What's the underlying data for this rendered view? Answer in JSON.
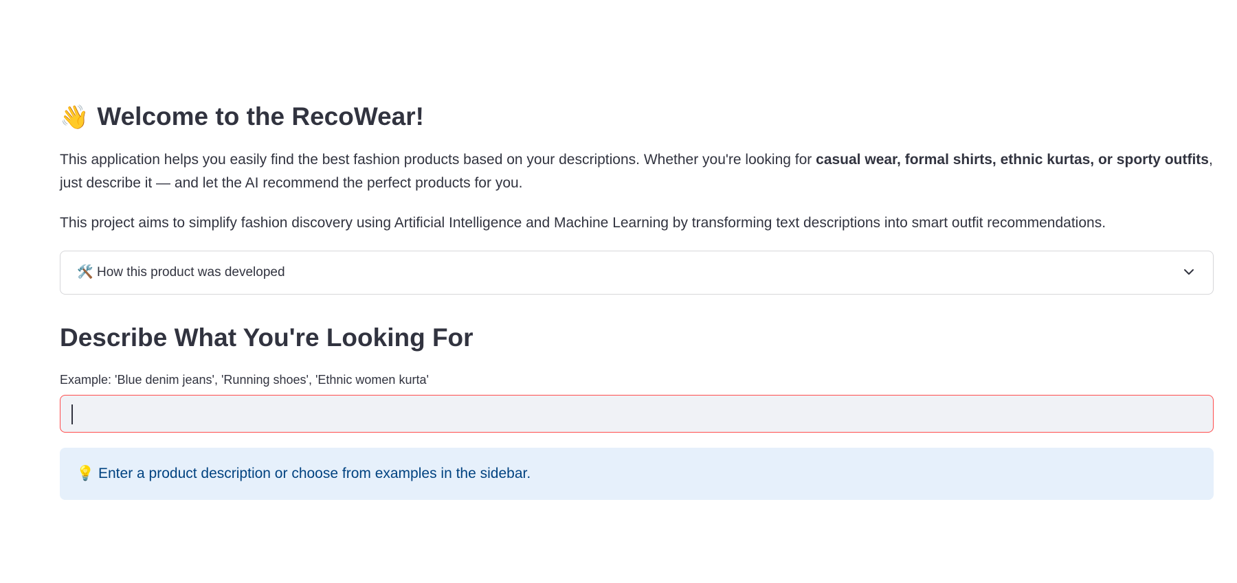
{
  "header": {
    "emoji": "👋",
    "title": "Welcome to the RecoWear!"
  },
  "intro": {
    "text_before": "This application helps you easily find the best fashion products based on your descriptions. Whether you're looking for ",
    "bold_text": "casual wear, formal shirts, ethnic kurtas, or sporty outfits",
    "text_after": ", just describe it — and let the AI recommend the perfect products for you."
  },
  "aim": {
    "text": "This project aims to simplify fashion discovery using Artificial Intelligence and Machine Learning by transforming text descriptions into smart outfit recommendations."
  },
  "expander": {
    "emoji": "🛠️",
    "label": "How this product was developed",
    "expanded": false
  },
  "search_section": {
    "heading": "Describe What You're Looking For",
    "input_label": "Example: 'Blue denim jeans', 'Running shoes', 'Ethnic women kurta'",
    "input_value": "",
    "input_placeholder": ""
  },
  "info_box": {
    "emoji": "💡",
    "text": "Enter a product description or choose from examples in the sidebar."
  },
  "colors": {
    "text": "#31333f",
    "input_border": "#ff4b4b",
    "input_bg": "#f0f2f6",
    "info_bg": "#e6f0fb",
    "info_text": "#004280"
  },
  "icons": {
    "title_icon": "waving-hand-icon",
    "expander_icon": "hammer-and-wrench-icon",
    "expander_toggle_icon": "chevron-down-icon",
    "info_icon": "light-bulb-icon"
  }
}
